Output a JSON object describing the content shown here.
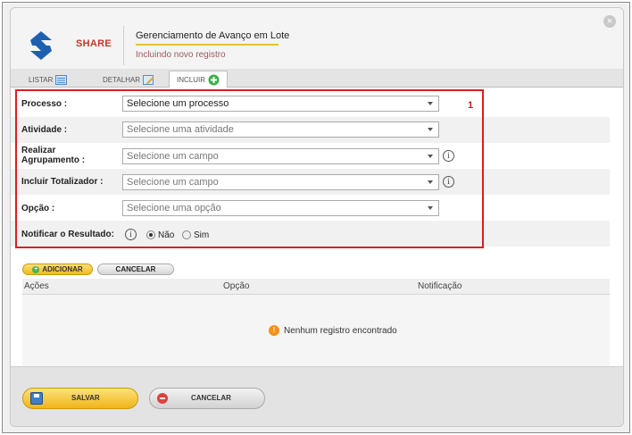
{
  "header": {
    "brand": "SHARE",
    "title": "Gerenciamento de Avanço em Lote",
    "subtitle": "Incluindo novo registro",
    "close_icon": "close-icon"
  },
  "tabs": [
    {
      "label": "LISTAR",
      "icon": "list-icon"
    },
    {
      "label": "DETALHAR",
      "icon": "edit-icon"
    },
    {
      "label": "INCLUIR",
      "icon": "add-icon",
      "active": true
    }
  ],
  "form": {
    "marker": "1",
    "processo": {
      "label": "Processo :",
      "value": "Selecione um processo"
    },
    "atividade": {
      "label": "Atividade :",
      "placeholder": "Selecione uma atividade"
    },
    "agrupamento": {
      "label_line1": "Realizar",
      "label_line2": "Agrupamento :",
      "placeholder": "Selecione um campo"
    },
    "totalizador": {
      "label": "Incluir Totalizador :",
      "placeholder": "Selecione um campo"
    },
    "opcao": {
      "label": "Opção :",
      "placeholder": "Selecione uma opção"
    },
    "notificar": {
      "label": "Notificar o Resultado:",
      "option_no": "Não",
      "option_yes": "Sim",
      "selected": "Não"
    }
  },
  "actions": {
    "add": "ADICIONAR",
    "cancel": "CANCELAR"
  },
  "grid": {
    "columns": [
      "Ações",
      "Opção",
      "Notificação"
    ],
    "empty_message": "Nenhum registro encontrado"
  },
  "footer": {
    "save": "SALVAR",
    "cancel": "CANCELAR"
  },
  "colors": {
    "accent": "#e6c230",
    "highlight_box": "#dd1e1e",
    "brand": "#c0392b"
  }
}
